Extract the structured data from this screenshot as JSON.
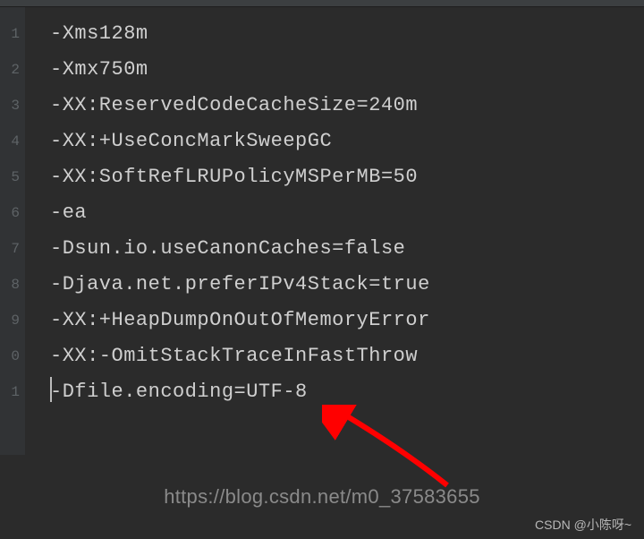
{
  "editor": {
    "gutter": [
      "1",
      "2",
      "3",
      "4",
      "5",
      "6",
      "7",
      "8",
      "9",
      "0",
      "1"
    ],
    "lines": [
      "-Xms128m",
      "-Xmx750m",
      "-XX:ReservedCodeCacheSize=240m",
      "-XX:+UseConcMarkSweepGC",
      "-XX:SoftRefLRUPolicyMSPerMB=50",
      "-ea",
      "-Dsun.io.useCanonCaches=false",
      "-Djava.net.preferIPv4Stack=true",
      "-XX:+HeapDumpOnOutOfMemoryError",
      "-XX:-OmitStackTraceInFastThrow",
      "-Dfile.encoding=UTF-8"
    ]
  },
  "annotation": {
    "arrow_color": "#ff0000"
  },
  "watermark": {
    "url": "https://blog.csdn.net/m0_37583655",
    "author": "CSDN @小陈呀~"
  }
}
